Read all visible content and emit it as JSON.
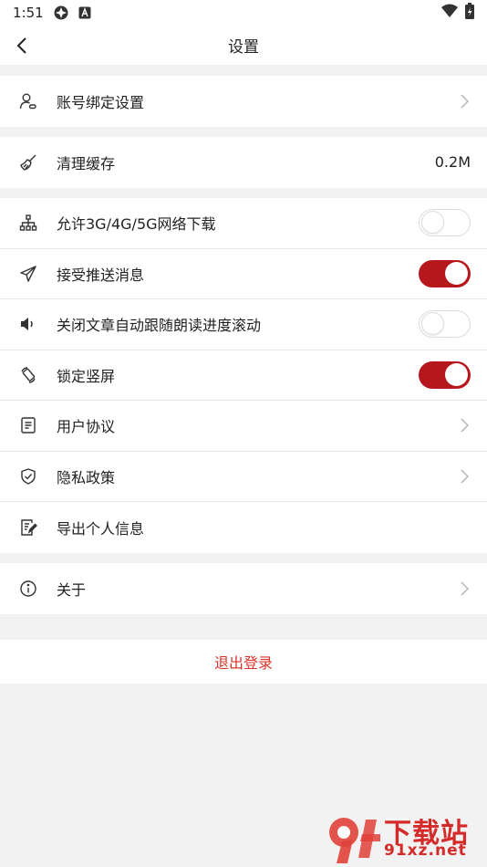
{
  "status_bar": {
    "time": "1:51"
  },
  "header": {
    "title": "设置"
  },
  "groups": {
    "account": {
      "label": "账号绑定设置"
    },
    "cache": {
      "label": "清理缓存",
      "value": "0.2M"
    },
    "settings": {
      "network_download": {
        "label": "允许3G/4G/5G网络下载",
        "enabled": false
      },
      "push": {
        "label": "接受推送消息",
        "enabled": true
      },
      "read_scroll": {
        "label": "关闭文章自动跟随朗读进度滚动",
        "enabled": false
      },
      "lock_portrait": {
        "label": "锁定竖屏",
        "enabled": true
      },
      "user_agreement": {
        "label": "用户协议"
      },
      "privacy": {
        "label": "隐私政策"
      },
      "export_info": {
        "label": "导出个人信息"
      }
    },
    "about": {
      "label": "关于"
    }
  },
  "logout": {
    "label": "退出登录"
  },
  "watermark": {
    "logo": "9f-logo-icon",
    "text_cn": "下载站",
    "text_url": "91xz.net"
  },
  "colors": {
    "accent": "#b5171c",
    "logout_text": "#d8342b",
    "background": "#f2f2f2"
  }
}
